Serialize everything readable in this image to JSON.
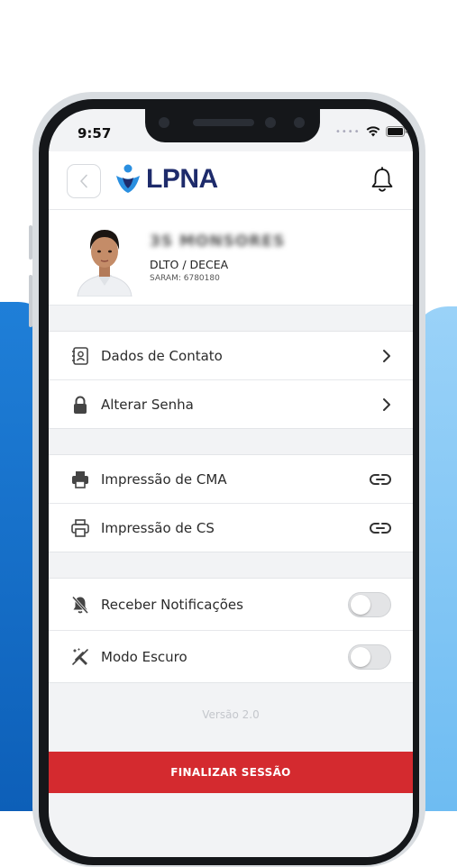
{
  "status_bar": {
    "time": "9:57"
  },
  "header": {
    "brand": "LPNA"
  },
  "profile": {
    "name": "3S MONSORES",
    "organization": "DLTO / DECEA",
    "saram": "SARAM: 6780180"
  },
  "menu": {
    "account": [
      {
        "label": "Dados de Contato",
        "icon": "contact-card-icon",
        "action": "chevron-right-icon"
      },
      {
        "label": "Alterar Senha",
        "icon": "lock-icon",
        "action": "chevron-right-icon"
      }
    ],
    "print": [
      {
        "label": "Impressão de CMA",
        "icon": "printer-icon",
        "action": "link-icon"
      },
      {
        "label": "Impressão de CS",
        "icon": "printer-outline-icon",
        "action": "link-icon"
      }
    ],
    "preferences": [
      {
        "label": "Receber Notificações",
        "icon": "bell-off-icon",
        "enabled": false
      },
      {
        "label": "Modo Escuro",
        "icon": "dark-mode-icon",
        "enabled": false
      }
    ]
  },
  "version": "Versão 2.0",
  "logout_label": "FINALIZAR SESSÃO",
  "colors": {
    "brand_navy": "#1e2b6b",
    "brand_accent": "#2a8fe0",
    "logout_red": "#d42a2f",
    "background": "#f2f3f5"
  }
}
